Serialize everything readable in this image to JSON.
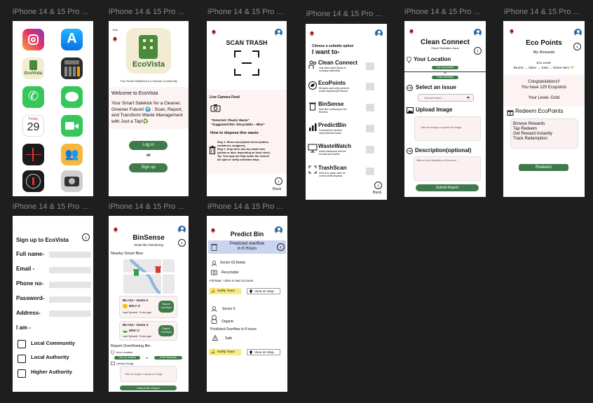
{
  "frame_label": "iPhone 14 & 15 Pro ...",
  "icons": {
    "back": "‹",
    "bell": "bell-icon",
    "avatar": "profile-icon"
  },
  "home": {
    "apps": [
      "Instagram",
      "App Store",
      "EcoVista",
      "Calculator",
      "Phone",
      "Messages",
      "Calendar",
      "FaceTime",
      "Voice Memos",
      "Family Sharing",
      "Compass",
      "Camera"
    ],
    "calendar_day": "Friday",
    "calendar_date": "29"
  },
  "welcome": {
    "exit": "Exit",
    "logo": "EcoVista",
    "tagline": "Your Smart Sidekick for a Cleaner Community",
    "welcome": "Welcome to EcoVista",
    "body": "Your Smart Sidekick for a Cleaner, Greener Future! 🌍 : Scan, Report, and Transform Waste Management with Just a Tap!♻️",
    "login": "Log in",
    "or": "or",
    "signup": "Sign up"
  },
  "scan": {
    "title": "SCAN TRASH",
    "live_feed": "Live Camera Feed",
    "detected": "\"Detected: Plastic Waste\"",
    "suggested": "\"Suggested Bin: Recyclable – Blue\"",
    "how": "How to dispose this waste",
    "steps": [
      "Step 1: Rinse used plastic items (bottles,",
      "containers, wrappers).",
      "Step 2: Drop them into dry waste bins",
      "(yellow or blue, depending on local rules).",
      "Tip: Your app can help locate the nearest",
      "bin spot or notify collection days."
    ],
    "back": "Back"
  },
  "menu": {
    "intro": "Choose a suitable option",
    "heading": "I want to-",
    "items": [
      {
        "title": "Clean Connect",
        "desc": [
          "Lets users report issues to",
          "municipal authorities"
        ]
      },
      {
        "title": "EcoPoints",
        "desc": [
          "Rewards users with points for",
          "proper disposal (QR-based)"
        ]
      },
      {
        "title": "BinSense",
        "desc": [
          "Real-time monitoring of bin",
          "fill levels"
        ]
      },
      {
        "title": "PredictBin",
        "desc": [
          "Forecasts bin overflow",
          "using historical trends"
        ]
      },
      {
        "title": "WasteWatch",
        "desc": [
          "Admin dashboard with live",
          "bin data and reports"
        ]
      },
      {
        "title": "TrashScan",
        "desc": [
          "Uses AI to guide users for",
          "correct waste disposal."
        ]
      }
    ],
    "back": "Back"
  },
  "clean": {
    "title": "Clean Connect",
    "subtitle": "Report Sanitation Issue",
    "your_location": "Your Location",
    "use_location": "Use my location",
    "or": "or",
    "enter_manually": "Enter Manually",
    "select_issue": "Select an issue",
    "choose": "Choose Issue...",
    "upload": "Upload Image",
    "upload_hint": "Take an image or upload an image",
    "description": "Description(optional)",
    "desc_hint": "Write a short description of the issue...",
    "submit": "Submit Report"
  },
  "points": {
    "title": "Eco Points",
    "subtitle": "My Rewards",
    "level_label": "Eco Level:",
    "levels": "Bronze → Silver → Gold → Green Hero 🌱",
    "congrats": "Congratulations!!",
    "points": "You have 125 Ecopoints",
    "level": "Your Level- Gold",
    "redeem_heading": "Redeem EcoPoints",
    "options": [
      "Browse Rewards",
      "Tap Redeem",
      "Get Reward Instantly",
      "Track Redemption"
    ],
    "redeem": "Redeem"
  },
  "signup": {
    "title": "Sign up  to EcoVista",
    "fields": [
      "Full name-",
      "Email -",
      "Phone no-",
      "Password-",
      "Address-"
    ],
    "iam": "I am -",
    "options": [
      "Local Community",
      "Local Authority",
      "Higher Authority"
    ]
  },
  "binsense": {
    "title": "BinSense",
    "subtitle": "Smart Bin Monitoring",
    "nearby": "Nearby Smart Bins",
    "bins": [
      {
        "name": "Bin #23 – Sector 5",
        "pct": "90%",
        "status": "Full",
        "synced": "Last Synced : 5 min ago",
        "btn": "Report Overflow",
        "color": "#f2c300",
        "fill": 0.9
      },
      {
        "name": "Bin #44 – Sector 4",
        "pct": "45%",
        "status": "Full",
        "synced": "Last Synced : 5 min ago",
        "btn": "Report Overflow",
        "color": "#35b53c",
        "fill": 0.45
      }
    ],
    "report_heading": "Report  Overflowing Bin",
    "your_location": "Your Location",
    "use_location": "Use my location",
    "or": "or",
    "enter_manually": "Enter Manually",
    "upload": "Upload Image",
    "upload_hint": "Take an image or upload an image",
    "submit": "Submit Bin Report"
  },
  "predict": {
    "title": "Predict Bin",
    "banner": [
      "Predicted overflow",
      "in 6 Hours"
    ],
    "b1": {
      "location": "Sector 63,Noida",
      "type": "Recyclable",
      "rate": "Fill Rate: +25% in last 24 hours"
    },
    "notify": "Notify Team",
    "map": "View on Map",
    "b2": {
      "location": "Sector 5",
      "type": "Organic",
      "overflow": "Predicted Overflow  In 8 hours",
      "status": "Safe"
    }
  }
}
